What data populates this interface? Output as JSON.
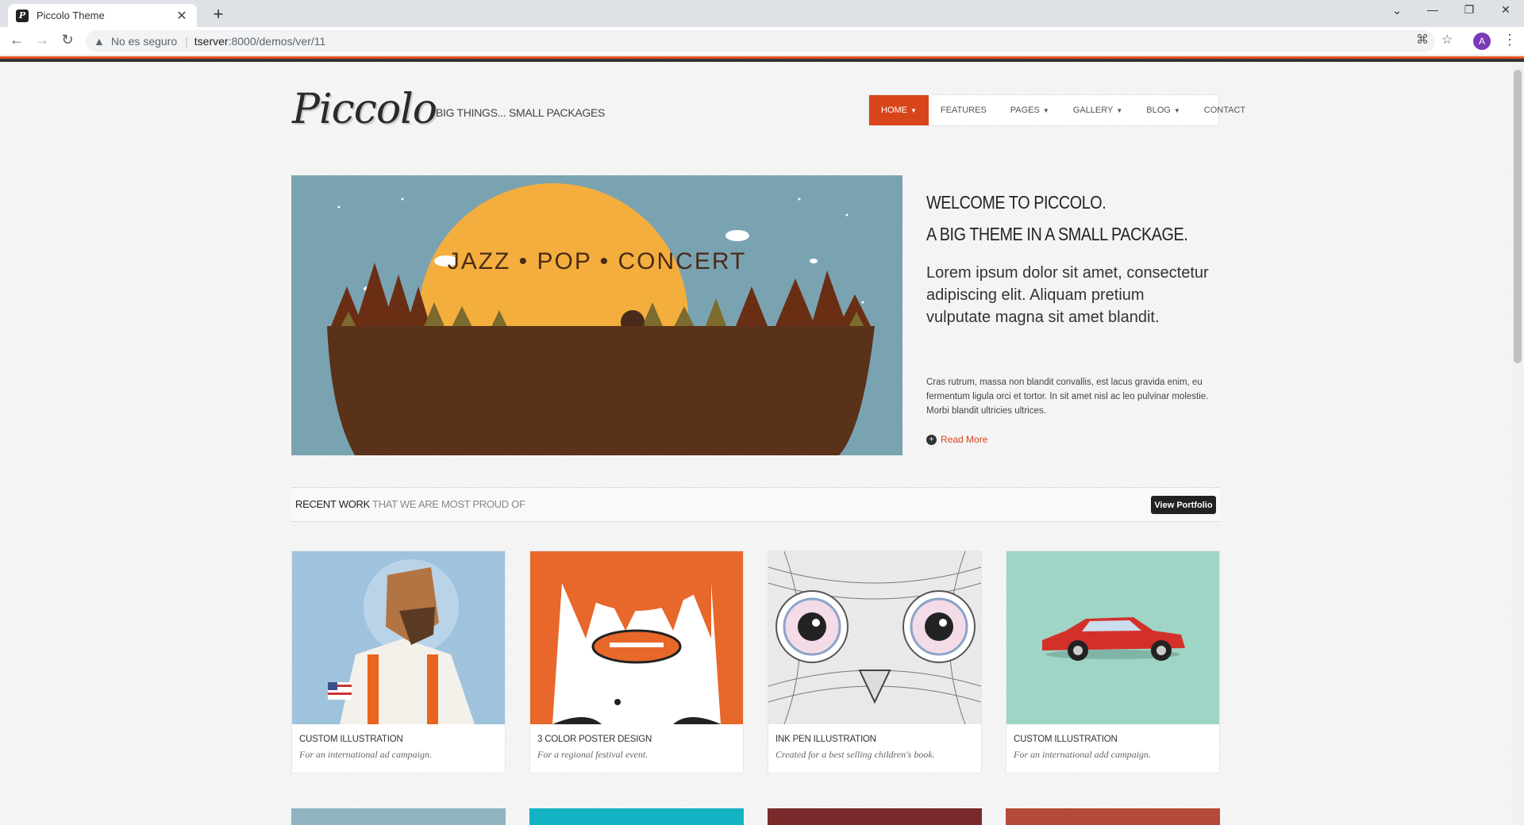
{
  "browser": {
    "tab_title": "Piccolo Theme",
    "security_label": "No es seguro",
    "url_host": "tserver",
    "url_path": ":8000/demos/ver/11",
    "avatar_letter": "A"
  },
  "site": {
    "logo": "Piccolo",
    "tagline": "BIG THINGS... SMALL PACKAGES",
    "accent": "#d9451a"
  },
  "nav": {
    "items": [
      {
        "label": "HOME",
        "caret": true,
        "active": true
      },
      {
        "label": "FEATURES",
        "caret": false
      },
      {
        "label": "PAGES",
        "caret": true
      },
      {
        "label": "GALLERY",
        "caret": true
      },
      {
        "label": "BLOG",
        "caret": true
      },
      {
        "label": "CONTACT",
        "caret": false
      }
    ]
  },
  "hero": {
    "banner_text": "JAZZ • POP • CONCERT"
  },
  "intro": {
    "heading_1": "WELCOME TO PICCOLO.",
    "heading_2": "A BIG THEME IN A SMALL PACKAGE.",
    "lead": "Lorem ipsum dolor sit amet, consectetur adipiscing elit. Aliquam pretium vulputate magna sit amet blandit.",
    "body": "Cras rutrum, massa non blandit convallis, est lacus gravida enim, eu fermentum ligula orci et tortor. In sit amet nisl ac leo pulvinar molestie. Morbi blandit ultricies ultrices.",
    "read_more": "Read More"
  },
  "recent": {
    "title": "RECENT WORK",
    "subtitle": "THAT WE ARE MOST PROUD OF",
    "button": "View Portfolio",
    "cards": [
      {
        "title": "CUSTOM ILLUSTRATION",
        "desc": "For an international ad campaign."
      },
      {
        "title": "3 COLOR POSTER DESIGN",
        "desc": "For a regional festival event."
      },
      {
        "title": "INK PEN ILLUSTRATION",
        "desc": "Created for a best selling children's book."
      },
      {
        "title": "CUSTOM ILLUSTRATION",
        "desc": "For an international add campaign."
      }
    ]
  }
}
